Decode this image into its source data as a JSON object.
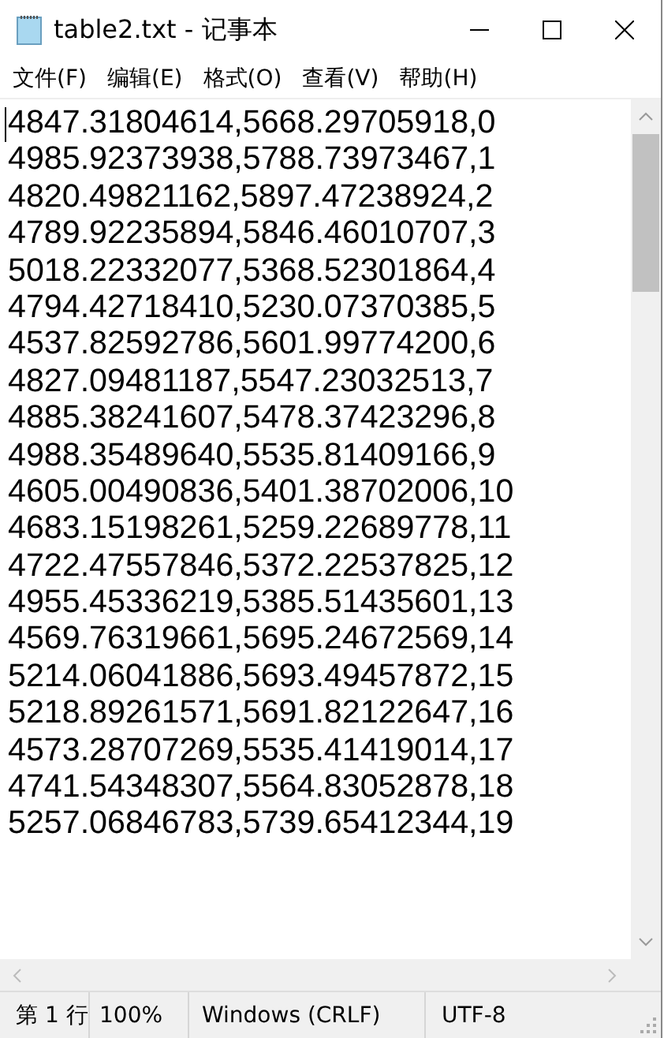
{
  "window": {
    "title": "table2.txt - 记事本"
  },
  "menu": [
    "文件(F)",
    "编辑(E)",
    "格式(O)",
    "查看(V)",
    "帮助(H)"
  ],
  "lines": [
    "4847.31804614,5668.29705918,0",
    "4985.92373938,5788.73973467,1",
    "4820.49821162,5897.47238924,2",
    "4789.92235894,5846.46010707,3",
    "5018.22332077,5368.52301864,4",
    "4794.42718410,5230.07370385,5",
    "4537.82592786,5601.99774200,6",
    "4827.09481187,5547.23032513,7",
    "4885.38241607,5478.37423296,8",
    "4988.35489640,5535.81409166,9",
    "4605.00490836,5401.38702006,10",
    "4683.15198261,5259.22689778,11",
    "4722.47557846,5372.22537825,12",
    "4955.45336219,5385.51435601,13",
    "4569.76319661,5695.24672569,14",
    "5214.06041886,5693.49457872,15",
    "5218.89261571,5691.82122647,16",
    "4573.28707269,5535.41419014,17",
    "4741.54348307,5564.83052878,18",
    "5257.06846783,5739.65412344,19"
  ],
  "status_bar": [
    "第 1 行",
    "100%",
    "Windows (CRLF)",
    "UTF-8"
  ]
}
